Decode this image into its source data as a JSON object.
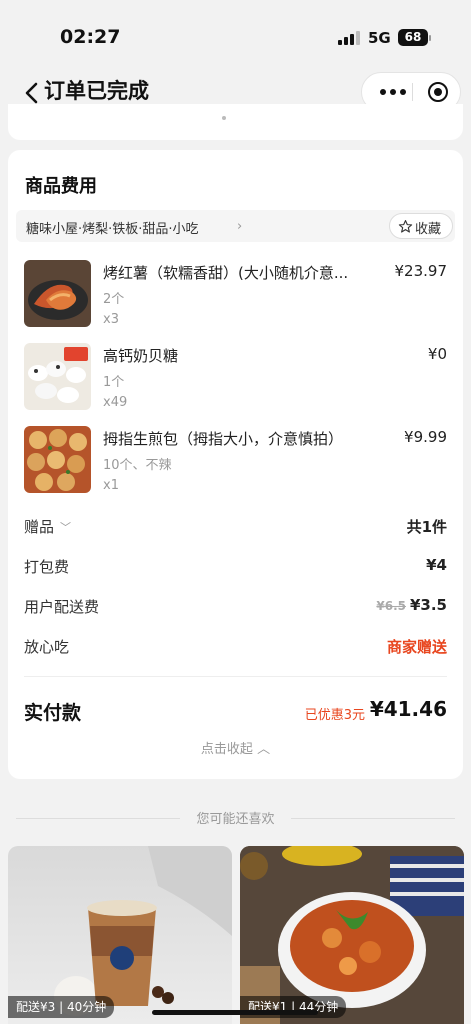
{
  "status": {
    "time": "02:27",
    "network": "5G",
    "battery": "68"
  },
  "nav": {
    "title": "订单已完成"
  },
  "card": {
    "title": "商品费用",
    "shop_name": "糖味小屋·烤梨·铁板·甜品·小吃",
    "favorite_label": "收藏"
  },
  "items": [
    {
      "name": "烤红薯（软糯香甜）(大小随机介意...",
      "spec": "2个",
      "qty": "x3",
      "price": "¥23.97"
    },
    {
      "name": "高钙奶贝糖",
      "spec": "1个",
      "qty": "x49",
      "price": "¥0"
    },
    {
      "name": "拇指生煎包（拇指大小，介意慎拍）",
      "spec": "10个、不辣",
      "qty": "x1",
      "price": "¥9.99"
    }
  ],
  "fees": {
    "gift_label": "赠品",
    "gift_value": "共1件",
    "packing_label": "打包费",
    "packing_value": "¥4",
    "delivery_label": "用户配送费",
    "delivery_original": "¥6.5",
    "delivery_value": "¥3.5",
    "insurance_label": "放心吃",
    "insurance_value": "商家赠送"
  },
  "total": {
    "label": "实付款",
    "discount": "已优惠3元",
    "amount": "¥41.46",
    "collapse": "点击收起"
  },
  "recommend": {
    "title": "您可能还喜欢",
    "cards": [
      {
        "tag": "配送¥3 | 40分钟"
      },
      {
        "tag": "配送¥1 | 44分钟"
      }
    ]
  },
  "colors": {
    "accent_red": "#e8461f",
    "background": "#f2f2f2"
  }
}
